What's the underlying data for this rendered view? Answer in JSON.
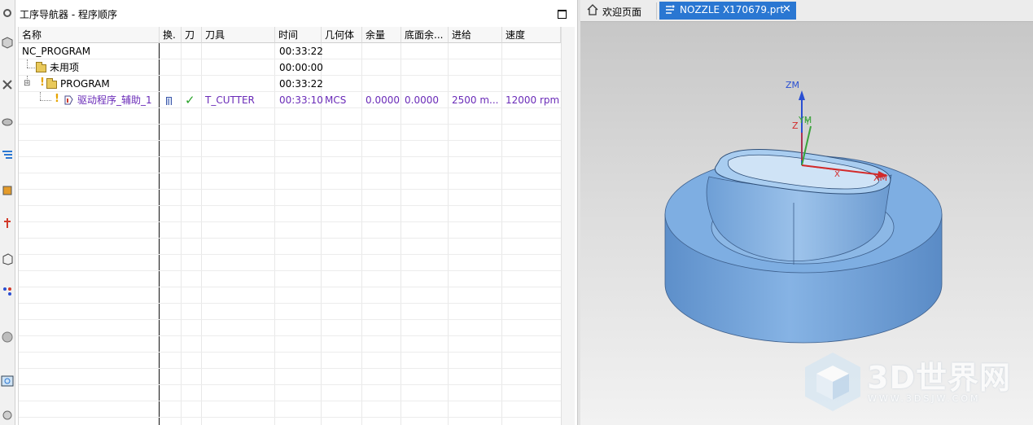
{
  "navigator": {
    "title": "工序导航器 - 程序顺序",
    "columns": [
      "名称",
      "换.",
      "刀",
      "刀具",
      "时间",
      "几何体",
      "余量",
      "底面余...",
      "进给",
      "速度"
    ],
    "rows": [
      {
        "name": "NC_PROGRAM",
        "tool": "",
        "time": "00:33:22",
        "geometry": "",
        "stock": "",
        "floor_stock": "",
        "feed": "",
        "speed": ""
      },
      {
        "name": "未用项",
        "tool": "",
        "time": "00:00:00",
        "geometry": "",
        "stock": "",
        "floor_stock": "",
        "feed": "",
        "speed": ""
      },
      {
        "name": "PROGRAM",
        "tool": "",
        "time": "00:33:22",
        "geometry": "",
        "stock": "",
        "floor_stock": "",
        "feed": "",
        "speed": ""
      },
      {
        "name": "驱动程序_辅助_1",
        "tool": "T_CUTTER",
        "time": "00:33:10",
        "geometry": "MCS",
        "stock": "0.0000",
        "floor_stock": "0.0000",
        "feed": "2500 m...",
        "speed": "12000 rpm",
        "status_check": "✓"
      }
    ]
  },
  "graphics": {
    "tabs": [
      {
        "label": "欢迎页面",
        "icon": "home-icon"
      },
      {
        "label": "NOZZLE X170679.prt",
        "icon": "part-file-icon",
        "active": true
      }
    ],
    "close_glyph": "✕",
    "axes": {
      "zm": "ZM",
      "ym": "YM",
      "xm": "XM",
      "z": "Z",
      "y": "Y",
      "x": "X"
    },
    "watermark": {
      "title": "3D世界网",
      "url": "WWW.3DSJW.COM"
    }
  },
  "colors": {
    "part_body": "#7aa8dc",
    "active_tab": "#2a77d2",
    "operation_text": "#6a2bb8",
    "check": "#2aa32a"
  }
}
